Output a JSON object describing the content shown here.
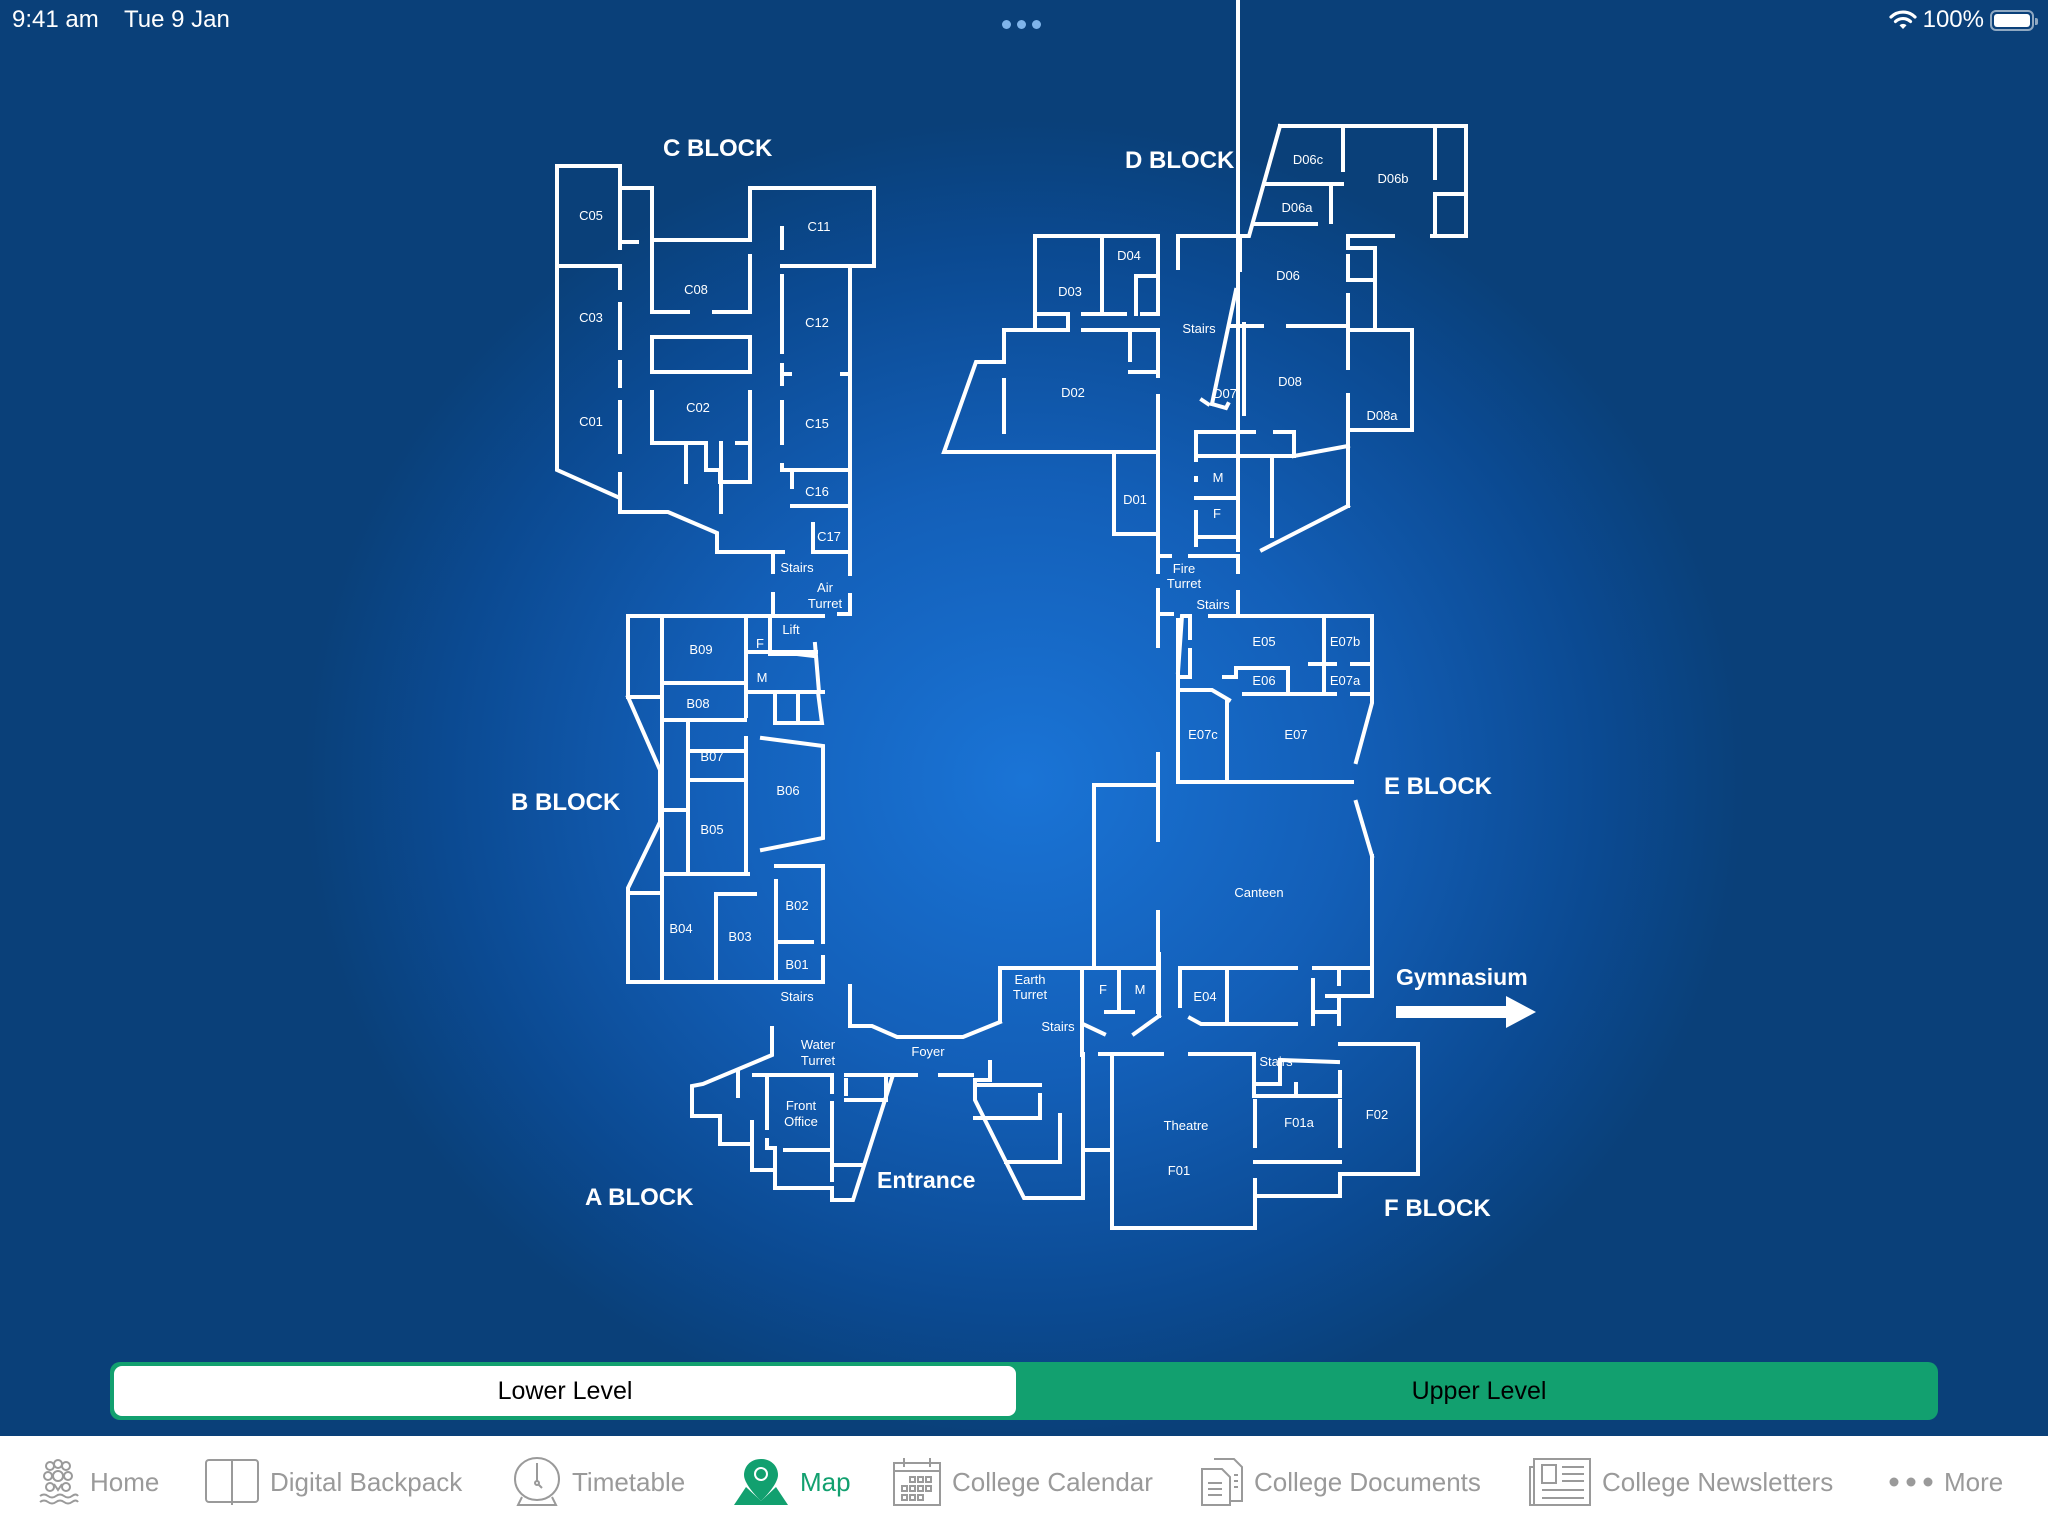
{
  "status_bar": {
    "time": "9:41 am",
    "date": "Tue 9 Jan",
    "battery": "100%",
    "battery_level": 1.0
  },
  "colors": {
    "accent": "#12a06f",
    "background": "#0b4a92",
    "wall": "#ffffff",
    "tab_inactive": "#9a9a9a"
  },
  "map": {
    "blocks": {
      "c": "C BLOCK",
      "d": "D BLOCK",
      "b": "B BLOCK",
      "e": "E BLOCK",
      "a": "A BLOCK",
      "f": "F BLOCK"
    },
    "landmarks": {
      "entrance": "Entrance",
      "gymnasium": "Gymnasium"
    },
    "rooms": {
      "c05": "C05",
      "c03": "C03",
      "c01": "C01",
      "c08": "C08",
      "c02": "C02",
      "c11": "C11",
      "c12": "C12",
      "c15": "C15",
      "c16": "C16",
      "c17": "C17",
      "c_stairs": "Stairs",
      "air_turret_1": "Air",
      "air_turret_2": "Turret",
      "lift": "Lift",
      "b_f": "F",
      "b_m": "M",
      "b09": "B09",
      "b08": "B08",
      "b07": "B07",
      "b06": "B06",
      "b05": "B05",
      "b04": "B04",
      "b03": "B03",
      "b02": "B02",
      "b01": "B01",
      "b_stairs": "Stairs",
      "water_turret_1": "Water",
      "water_turret_2": "Turret",
      "front_office_1": "Front",
      "front_office_2": "Office",
      "foyer": "Foyer",
      "earth_turret_1": "Earth",
      "earth_turret_2": "Turret",
      "earth_stairs": "Stairs",
      "e_f": "F",
      "e_m": "M",
      "d06c": "D06c",
      "d06b": "D06b",
      "d06a": "D06a",
      "d04": "D04",
      "d03": "D03",
      "d06": "D06",
      "d_stairs": "Stairs",
      "d02": "D02",
      "d07": "D07",
      "d08": "D08",
      "d08a": "D08a",
      "d01": "D01",
      "d_m": "M",
      "d_f": "F",
      "fire_turret_1": "Fire",
      "fire_turret_2": "Turret",
      "fire_stairs": "Stairs",
      "e05": "E05",
      "e07b": "E07b",
      "e06": "E06",
      "e07a": "E07a",
      "e07c": "E07c",
      "e07": "E07",
      "canteen": "Canteen",
      "e04": "E04",
      "f_stairs": "Stairs",
      "theatre": "Theatre",
      "f01": "F01",
      "f01a": "F01a",
      "f02": "F02"
    }
  },
  "level_selector": {
    "options": [
      {
        "label": "Lower Level",
        "selected": true
      },
      {
        "label": "Upper Level",
        "selected": false
      }
    ]
  },
  "tabbar": {
    "items": [
      {
        "label": "Home",
        "icon": "home-crest-icon",
        "active": false
      },
      {
        "label": "Digital Backpack",
        "icon": "book-icon",
        "active": false
      },
      {
        "label": "Timetable",
        "icon": "clock-icon",
        "active": false
      },
      {
        "label": "Map",
        "icon": "map-pin-icon",
        "active": true
      },
      {
        "label": "College Calendar",
        "icon": "calendar-icon",
        "active": false
      },
      {
        "label": "College Documents",
        "icon": "documents-icon",
        "active": false
      },
      {
        "label": "College Newsletters",
        "icon": "newspaper-icon",
        "active": false
      },
      {
        "label": "More",
        "icon": "more-dots-icon",
        "active": false
      }
    ]
  }
}
